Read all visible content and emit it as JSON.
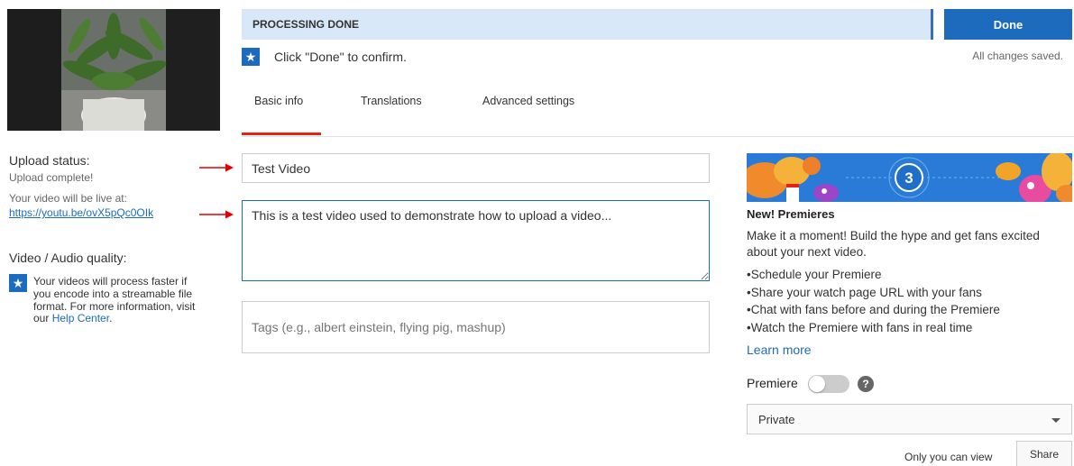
{
  "header": {
    "processing_status": "PROCESSING DONE",
    "done_label": "Done",
    "saved_text": "All changes saved.",
    "confirm_text": "Click \"Done\" to confirm."
  },
  "tabs": [
    {
      "label": "Basic info",
      "active": true
    },
    {
      "label": "Translations",
      "active": false
    },
    {
      "label": "Advanced settings",
      "active": false
    }
  ],
  "left_panel": {
    "upload_status_heading": "Upload status:",
    "upload_status_value": "Upload complete!",
    "live_at_text": "Your video will be live at:",
    "video_url": "https://youtu.be/ovX5pQc0OIk",
    "quality_heading": "Video / Audio quality:",
    "quality_info": "Your videos will process faster if you encode into a streamable file format. For more information, visit our",
    "help_center_link": "Help Center",
    "help_center_suffix": "."
  },
  "form": {
    "title_value": "Test Video",
    "description_value": "This is a test video used to demonstrate how to upload a video...",
    "tags_placeholder": "Tags (e.g., albert einstein, flying pig, mashup)"
  },
  "premieres": {
    "banner_number": "3",
    "title": "New! Premieres",
    "description": "Make it a moment! Build the hype and get fans excited about your next video.",
    "bullets": [
      "Schedule your Premiere",
      "Share your watch page URL with your fans",
      "Chat with fans before and during the Premiere",
      "Watch the Premiere with fans in real time"
    ],
    "learn_more": "Learn more",
    "premiere_label": "Premiere",
    "help_glyph": "?"
  },
  "privacy": {
    "selected": "Private",
    "hint": "Only you can view",
    "share_label": "Share"
  },
  "colors": {
    "accent_blue": "#1d6bbd",
    "processing_bg": "#d9e8f8",
    "tab_underline_red": "#e62117",
    "annotation_arrow_red": "#e00000"
  }
}
